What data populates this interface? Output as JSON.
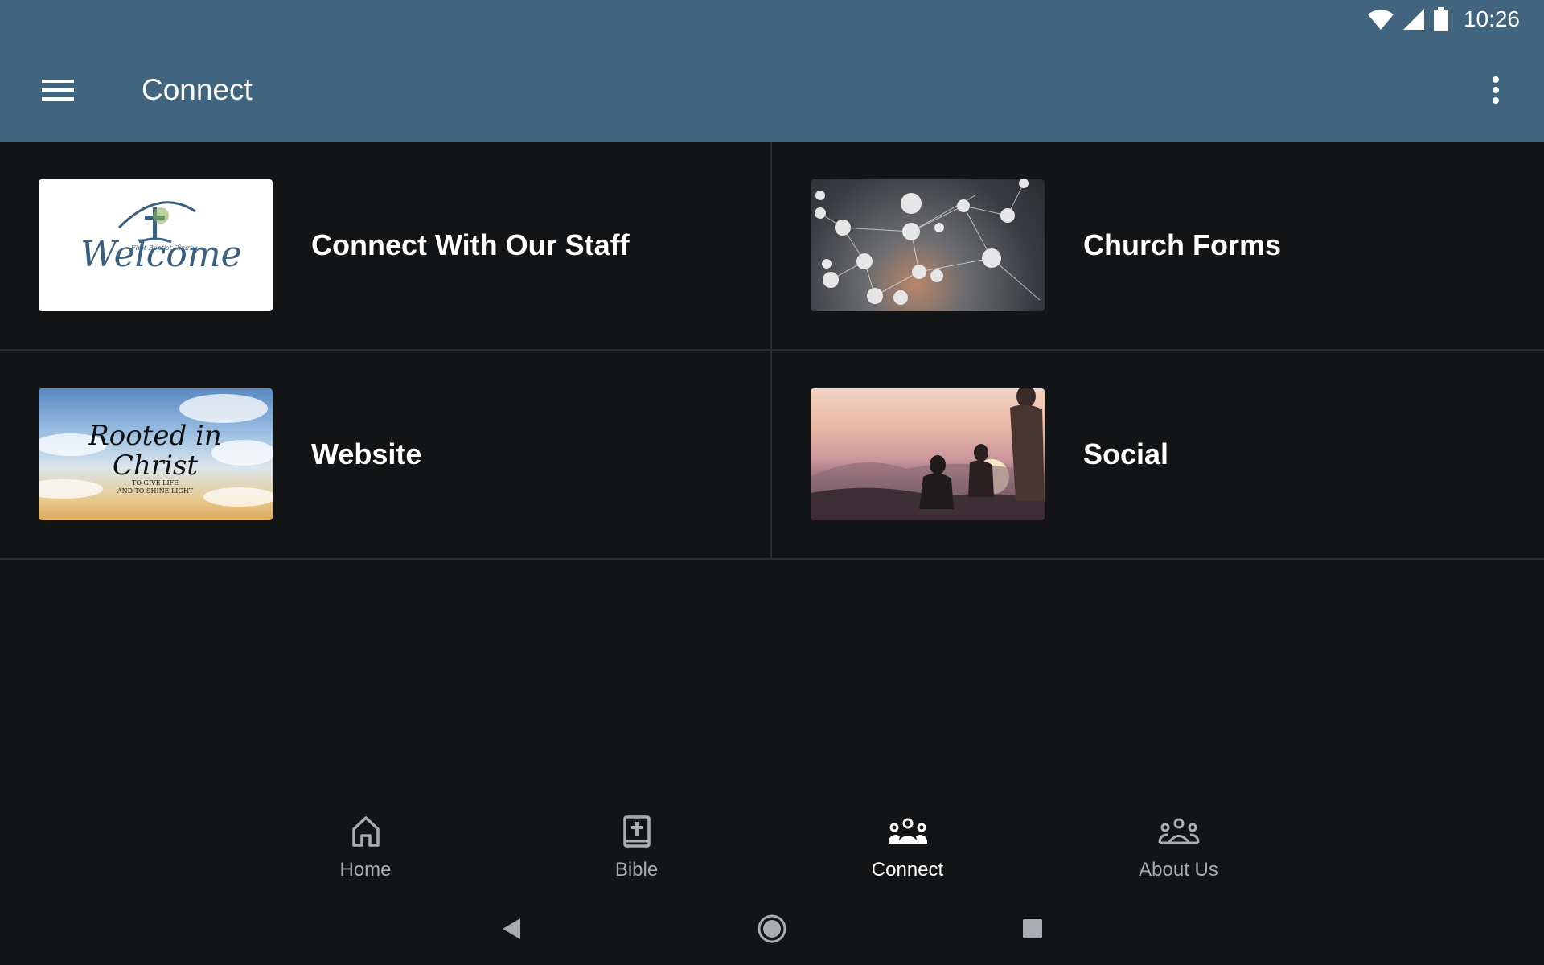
{
  "status_bar": {
    "time": "10:26"
  },
  "app_bar": {
    "title": "Connect"
  },
  "items": [
    {
      "label": "Connect With Our Staff",
      "thumb_text": "Welcome",
      "thumb_small": "First Baptist Church"
    },
    {
      "label": "Church Forms"
    },
    {
      "label": "Website",
      "thumb_line1": "Rooted in",
      "thumb_line2": "Christ",
      "thumb_sub1": "TO GIVE LIFE",
      "thumb_sub2": "AND TO SHINE LIGHT"
    },
    {
      "label": "Social"
    }
  ],
  "bottom_nav": [
    {
      "label": "Home",
      "icon": "home-icon"
    },
    {
      "label": "Bible",
      "icon": "bible-icon"
    },
    {
      "label": "Connect",
      "icon": "people-icon",
      "active": true
    },
    {
      "label": "About Us",
      "icon": "group-icon"
    }
  ],
  "colors": {
    "app_bar": "#41647f",
    "background": "#121416",
    "divider": "#2a2d31",
    "inactive_nav": "#a9acb1"
  }
}
